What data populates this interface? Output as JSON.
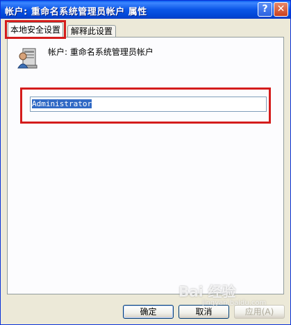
{
  "window": {
    "title": "帐户: 重命名系统管理员帐户 属性",
    "help_glyph": "?",
    "close_glyph": "✕"
  },
  "tabs": [
    {
      "label": "本地安全设置",
      "active": true
    },
    {
      "label": "解释此设置",
      "active": false
    }
  ],
  "setting": {
    "icon": "user-computer-icon",
    "label": "帐户: 重命名系统管理员帐户",
    "value": "Administrator"
  },
  "buttons": {
    "ok": "确定",
    "cancel": "取消",
    "apply": "应用(A)"
  },
  "watermark": {
    "brand": "Bai 经验",
    "url": "jingyan.baidu.com"
  },
  "colors": {
    "titlebar": "#0a55e6",
    "highlight_box": "#d41c1c",
    "selection": "#316ac5"
  }
}
